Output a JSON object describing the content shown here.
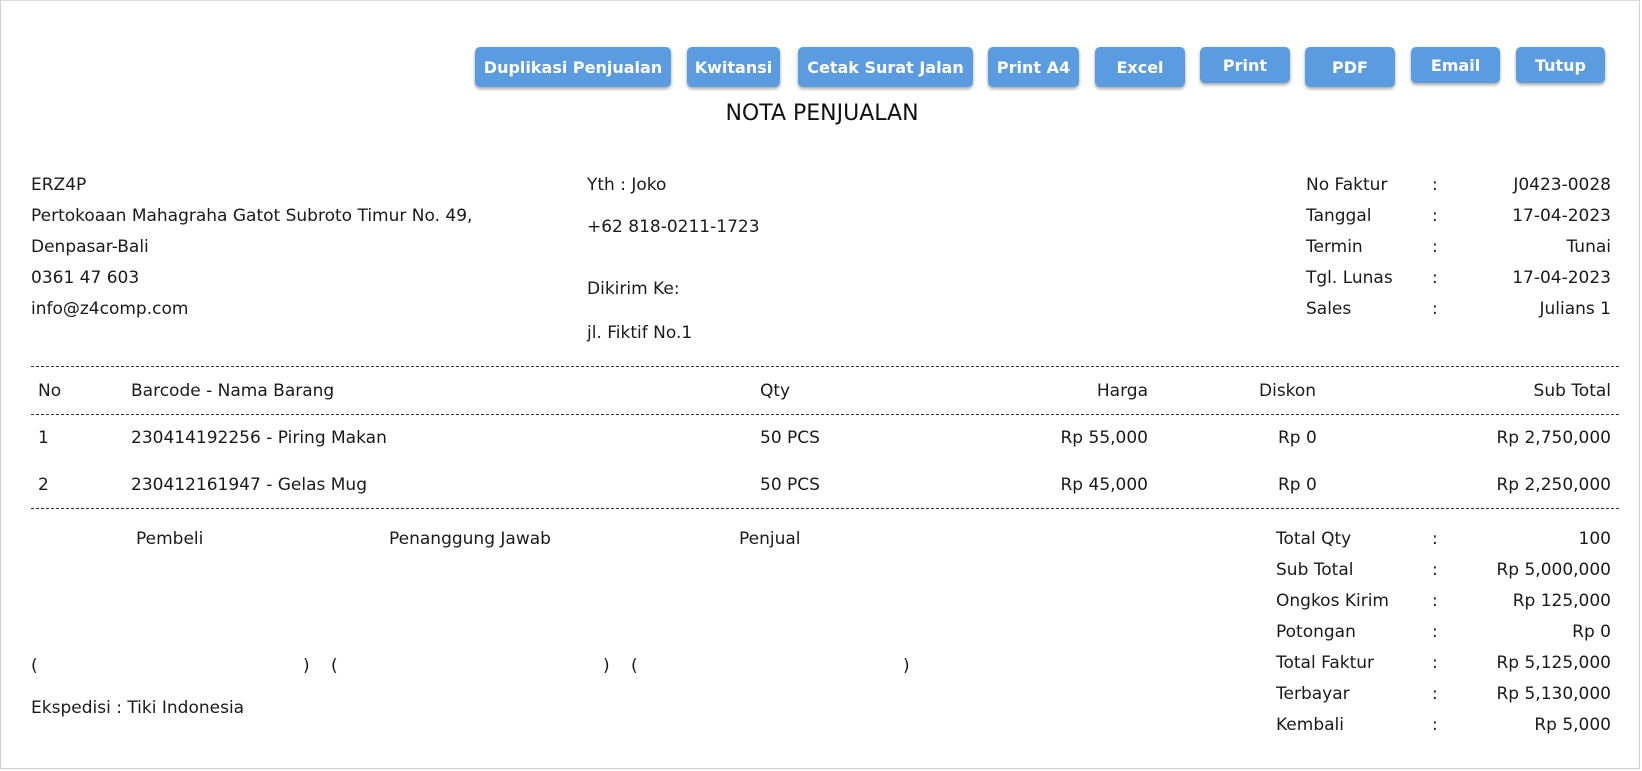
{
  "toolbar": {
    "duplikasi": "Duplikasi Penjualan",
    "kwitansi": "Kwitansi",
    "cetak_surat_jalan": "Cetak Surat Jalan",
    "print_a4": "Print A4",
    "excel": "Excel",
    "print": "Print",
    "pdf": "PDF",
    "email": "Email",
    "tutup": "Tutup"
  },
  "title": "NOTA PENJUALAN",
  "company": {
    "name": "ERZ4P",
    "address1": "Pertokoaan Mahagraha Gatot Subroto Timur No. 49,",
    "address2": "Denpasar-Bali",
    "phone": "0361 47 603",
    "email": "info@z4comp.com"
  },
  "customer": {
    "yth_label": "Yth :",
    "name": "Joko",
    "phone": "+62 818-0211-1723",
    "dikirim_label": "Dikirim Ke:",
    "address": "jl. Fiktif No.1"
  },
  "invoice": {
    "colon": ":",
    "fields": [
      {
        "label": "No Faktur",
        "value": "J0423-0028"
      },
      {
        "label": "Tanggal",
        "value": "17-04-2023"
      },
      {
        "label": "Termin",
        "value": "Tunai"
      },
      {
        "label": "Tgl. Lunas",
        "value": "17-04-2023"
      },
      {
        "label": "Sales",
        "value": "Julians 1"
      }
    ]
  },
  "table": {
    "headers": {
      "no": "No",
      "item": "Barcode - Nama Barang",
      "qty": "Qty",
      "harga": "Harga",
      "diskon": "Diskon",
      "subtotal": "Sub Total"
    },
    "rows": [
      {
        "no": "1",
        "item": "230414192256 - Piring Makan",
        "qty": "50 PCS",
        "harga": "Rp 55,000",
        "diskon": "Rp 0",
        "subtotal": "Rp 2,750,000"
      },
      {
        "no": "2",
        "item": "230412161947 - Gelas Mug",
        "qty": "50 PCS",
        "harga": "Rp 45,000",
        "diskon": "Rp 0",
        "subtotal": "Rp 2,250,000"
      }
    ]
  },
  "signatures": {
    "pembeli": "Pembeli",
    "penanggung": "Penanggung Jawab",
    "penjual": "Penjual",
    "open": "(",
    "close": ")"
  },
  "ekspedisi": "Ekspedisi : Tiki Indonesia",
  "totals": [
    {
      "label": "Total Qty",
      "value": "100"
    },
    {
      "label": "Sub Total",
      "value": "Rp 5,000,000"
    },
    {
      "label": "Ongkos Kirim",
      "value": "Rp 125,000"
    },
    {
      "label": "Potongan",
      "value": "Rp 0"
    },
    {
      "label": "Total Faktur",
      "value": "Rp 5,125,000"
    },
    {
      "label": "Terbayar",
      "value": "Rp 5,130,000"
    },
    {
      "label": "Kembali",
      "value": "Rp 5,000"
    }
  ],
  "colors": {
    "button": "#5b9be0"
  }
}
